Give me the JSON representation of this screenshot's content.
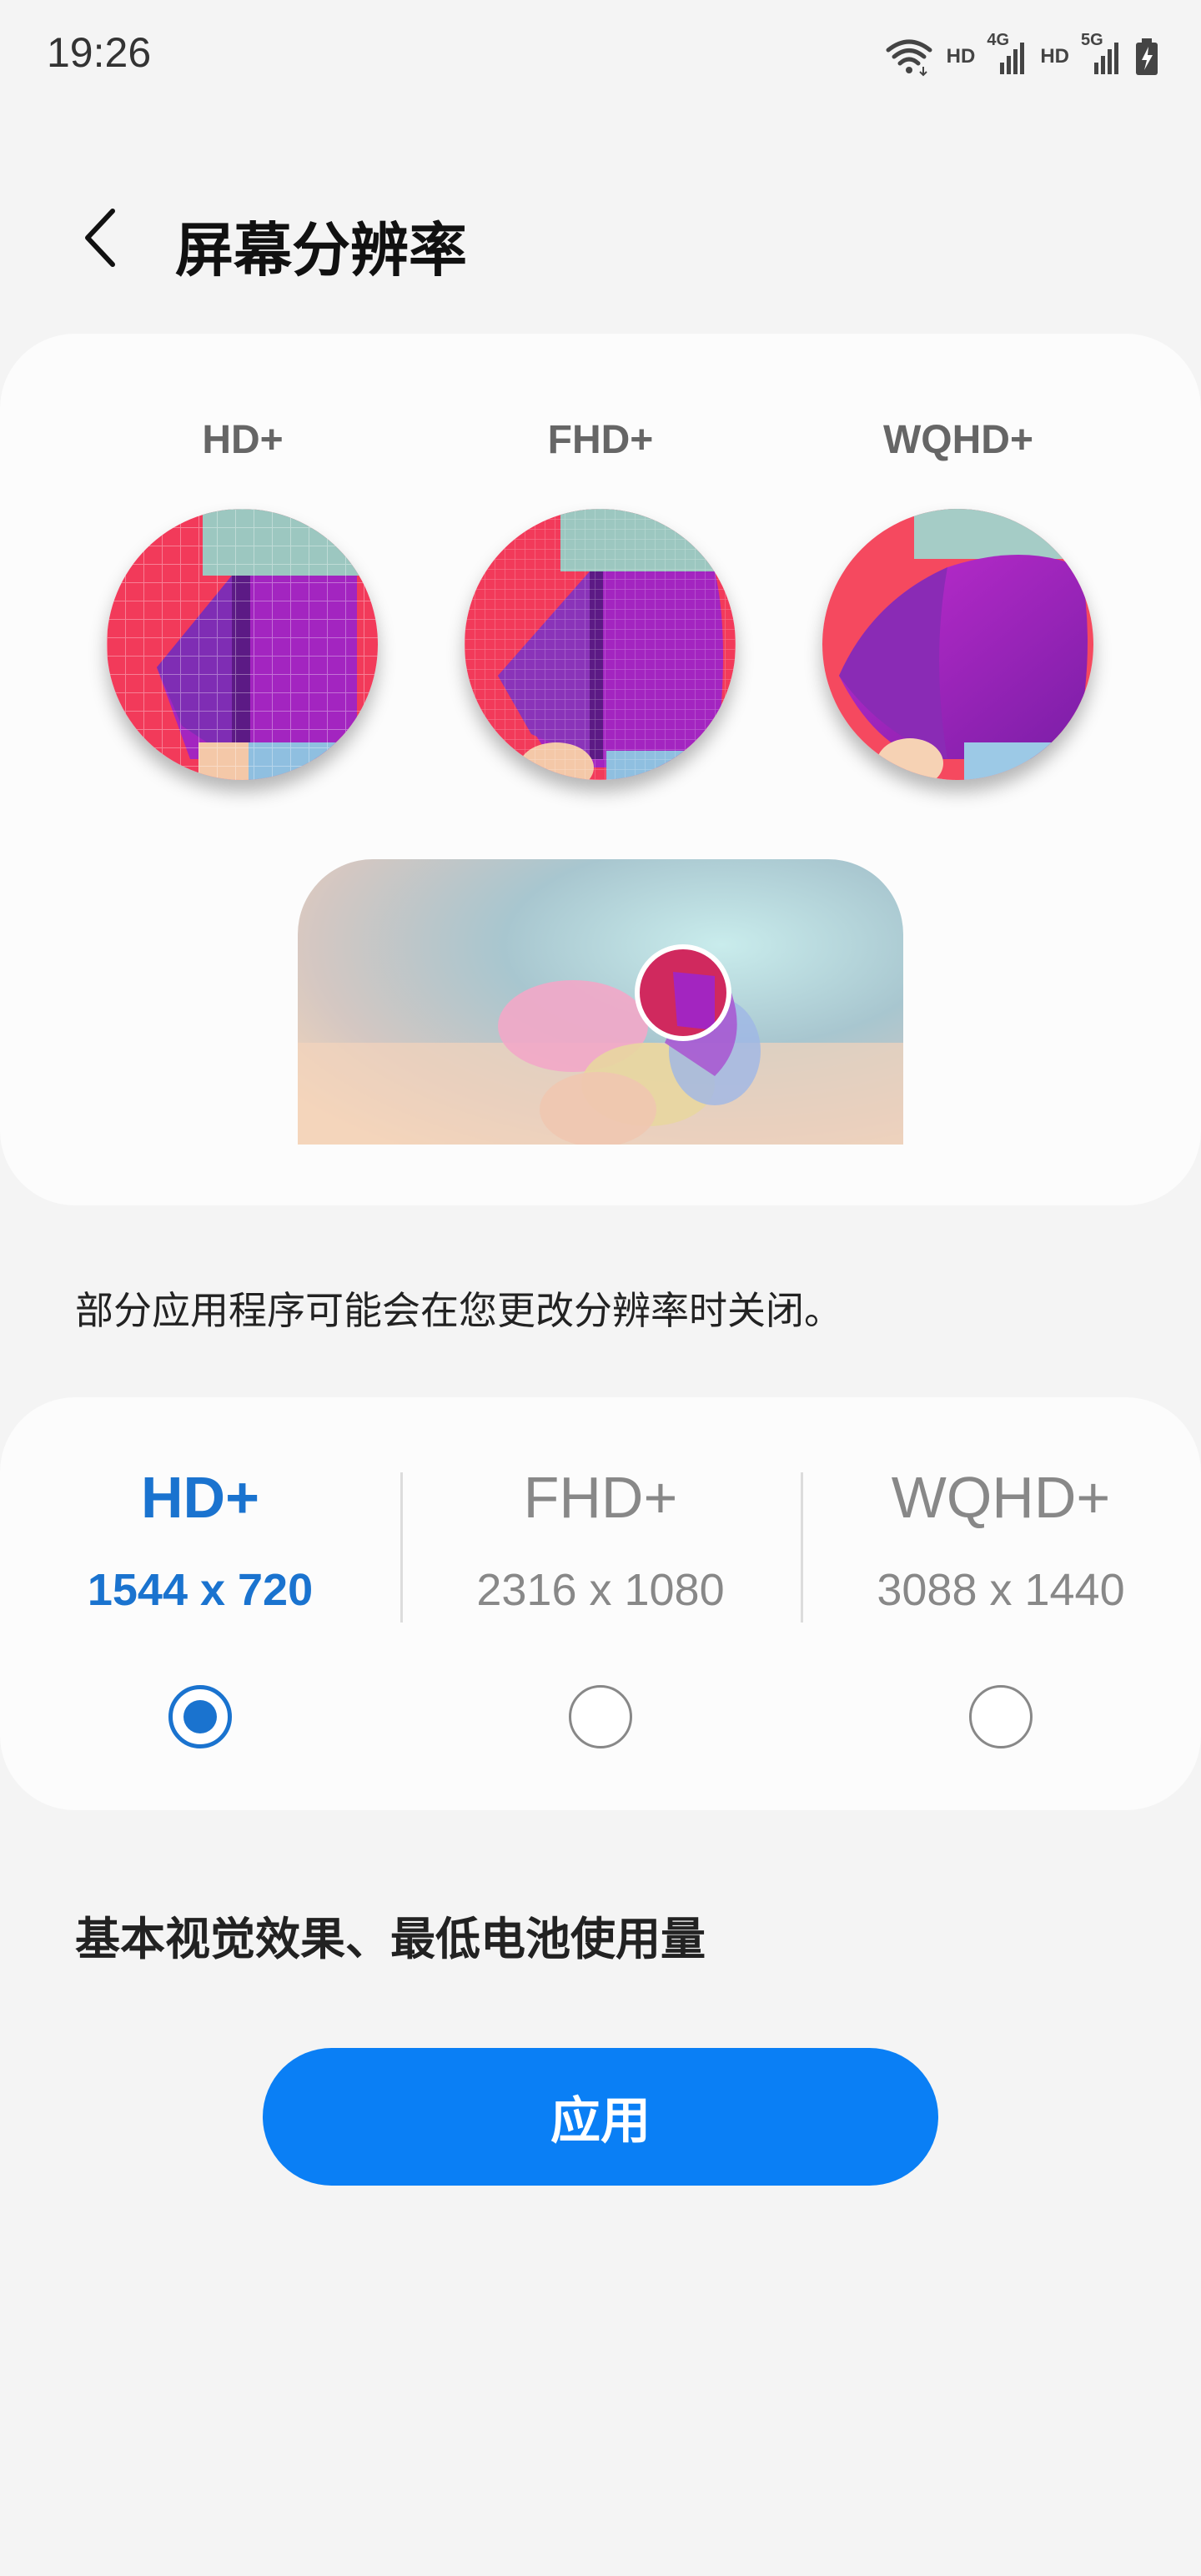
{
  "status_bar": {
    "time": "19:26",
    "hd_1": "HD",
    "net_1": "4G",
    "hd_2": "HD",
    "net_2": "5G"
  },
  "header": {
    "title": "屏幕分辨率"
  },
  "preview": {
    "labels": [
      "HD+",
      "FHD+",
      "WQHD+"
    ]
  },
  "note": "部分应用程序可能会在您更改分辨率时关闭。",
  "options": [
    {
      "name": "HD+",
      "dimensions": "1544 x 720",
      "selected": true
    },
    {
      "name": "FHD+",
      "dimensions": "2316 x 1080",
      "selected": false
    },
    {
      "name": "WQHD+",
      "dimensions": "3088 x 1440",
      "selected": false
    }
  ],
  "description": "基本视觉效果、最低电池使用量",
  "apply_label": "应用",
  "colors": {
    "accent": "#1a73cf",
    "button": "#0a7ff5",
    "background": "#f4f4f4",
    "card": "#fcfcfc"
  }
}
